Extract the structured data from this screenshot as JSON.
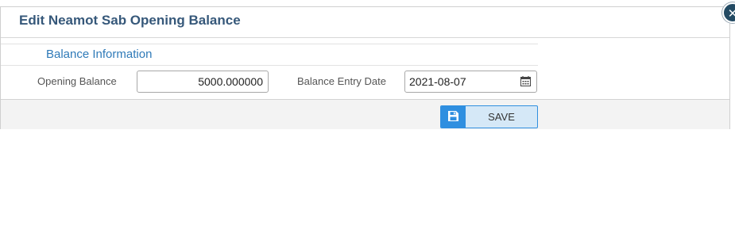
{
  "dialog": {
    "title": "Edit Neamot Sab Opening Balance",
    "close_icon": "close-icon"
  },
  "section": {
    "title": "Balance Information"
  },
  "fields": {
    "opening_balance": {
      "label": "Opening Balance",
      "value": "5000.000000"
    },
    "balance_entry_date": {
      "label": "Balance Entry Date",
      "value": "2021-08-07",
      "icon": "calendar-icon"
    }
  },
  "footer": {
    "save_label": "SAVE",
    "save_icon": "floppy-disk-icon"
  },
  "colors": {
    "title": "#36587a",
    "section_title": "#2f7ab8",
    "save_accent": "#2f8fe0",
    "save_bg": "#d5e8f7"
  }
}
